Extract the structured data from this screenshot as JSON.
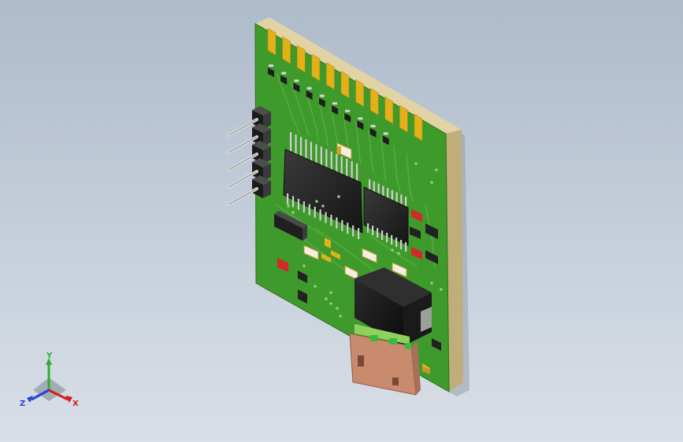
{
  "viewport": {
    "background_top": "#aebbcb",
    "background_bottom": "#d9dfe7"
  },
  "model": {
    "board_color": "#3f9a2c",
    "board_edge_color": "#c9b98a",
    "gold_finger_color": "#e2b11a",
    "finger_count": 11,
    "header_pin_count": 5,
    "connector_color": "#c98b6e"
  },
  "triad": {
    "x_label": "X",
    "y_label": "Y",
    "z_label": "Z",
    "x_color": "#d21f1f",
    "y_color": "#2fae2f",
    "z_color": "#2344d6"
  }
}
